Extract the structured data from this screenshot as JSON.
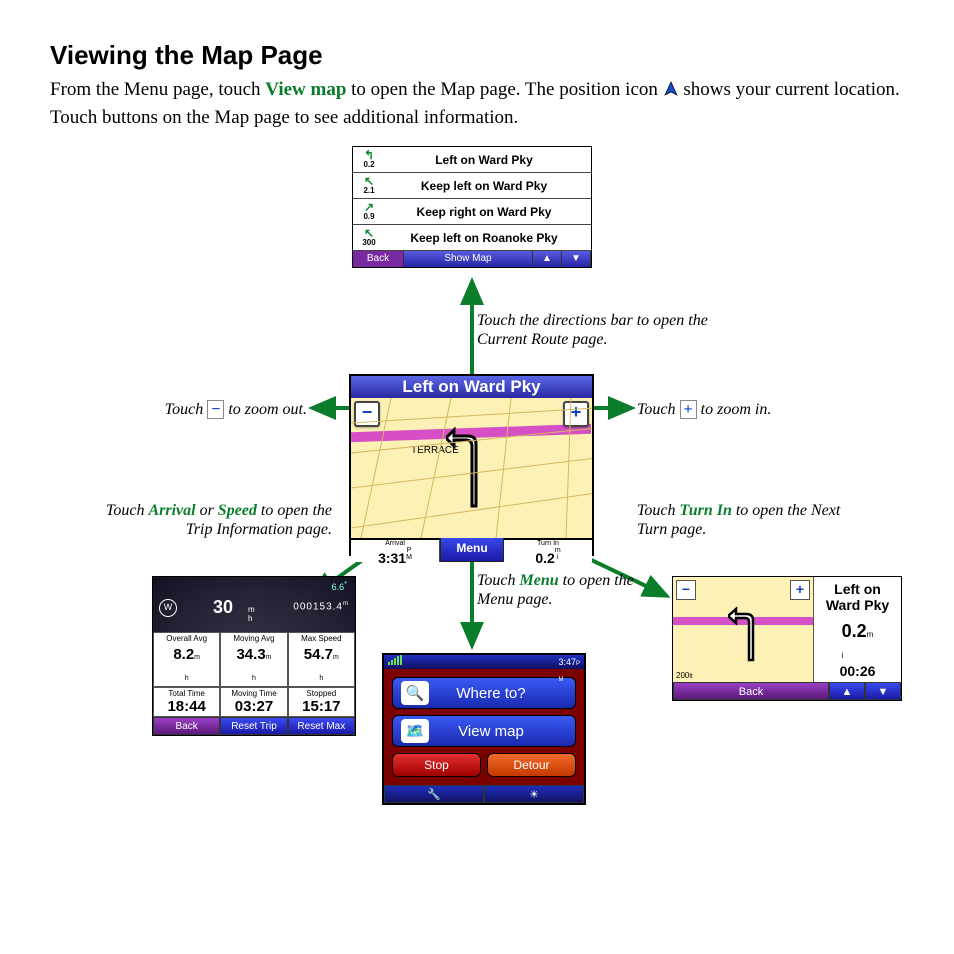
{
  "title": "Viewing the Map Page",
  "intro_pre": "From the Menu page, touch ",
  "intro_link": "View map",
  "intro_mid": " to open the Map page. The position icon ",
  "intro_post": " shows your current location. Touch buttons on the Map page to see additional information.",
  "annotations": {
    "directions_bar": "Touch the directions bar to open the Current Route page.",
    "zoom_out_pre": "Touch ",
    "zoom_out_post": " to zoom out.",
    "zoom_in_pre": "Touch ",
    "zoom_in_post": " to zoom in.",
    "trip_pre": "Touch ",
    "trip_w1": "Arrival",
    "trip_or": " or ",
    "trip_w2": "Speed",
    "trip_post": " to open the Trip Information page.",
    "turn_pre": "Touch ",
    "turn_w": "Turn In",
    "turn_post": " to open the Next Turn page.",
    "menu_pre": "Touch ",
    "menu_w": "Menu",
    "menu_post": " to open the Menu page."
  },
  "directions": {
    "rows": [
      {
        "dist": "0.2",
        "text": "Left on Ward Pky"
      },
      {
        "dist": "2.1",
        "text": "Keep left on Ward Pky"
      },
      {
        "dist": "0.9",
        "text": "Keep right on Ward Pky"
      },
      {
        "dist": "300",
        "text": "Keep left on Roanoke Pky"
      }
    ],
    "back": "Back",
    "show_map": "Show Map"
  },
  "map": {
    "title": "Left on Ward Pky",
    "terrace": "TERRACE",
    "arrival_lbl": "Arrival",
    "arrival_val": "3:31",
    "arrival_ampm": "P\nM",
    "menu": "Menu",
    "turnin_lbl": "Turn In",
    "turnin_val": "0.2",
    "turnin_unit": "m\ni"
  },
  "trip": {
    "compass": "W",
    "speed": "30",
    "speed_unit": "m\nh",
    "sats": "6.6",
    "odo": "000153.4",
    "cells": [
      {
        "l": "Overall Avg",
        "v": "8.2"
      },
      {
        "l": "Moving Avg",
        "v": "34.3"
      },
      {
        "l": "Max Speed",
        "v": "54.7"
      },
      {
        "l": "Total Time",
        "v": "18:44"
      },
      {
        "l": "Moving Time",
        "v": "03:27"
      },
      {
        "l": "Stopped",
        "v": "15:17"
      }
    ],
    "back": "Back",
    "reset_trip": "Reset Trip",
    "reset_max": "Reset Max"
  },
  "menu": {
    "time": "3:47",
    "where_to": "Where to?",
    "view_map": "View map",
    "stop": "Stop",
    "detour": "Detour"
  },
  "next_turn": {
    "label": "Left on Ward Pky",
    "dist": "0.2",
    "time": "00:26",
    "scale": "200",
    "back": "Back"
  }
}
